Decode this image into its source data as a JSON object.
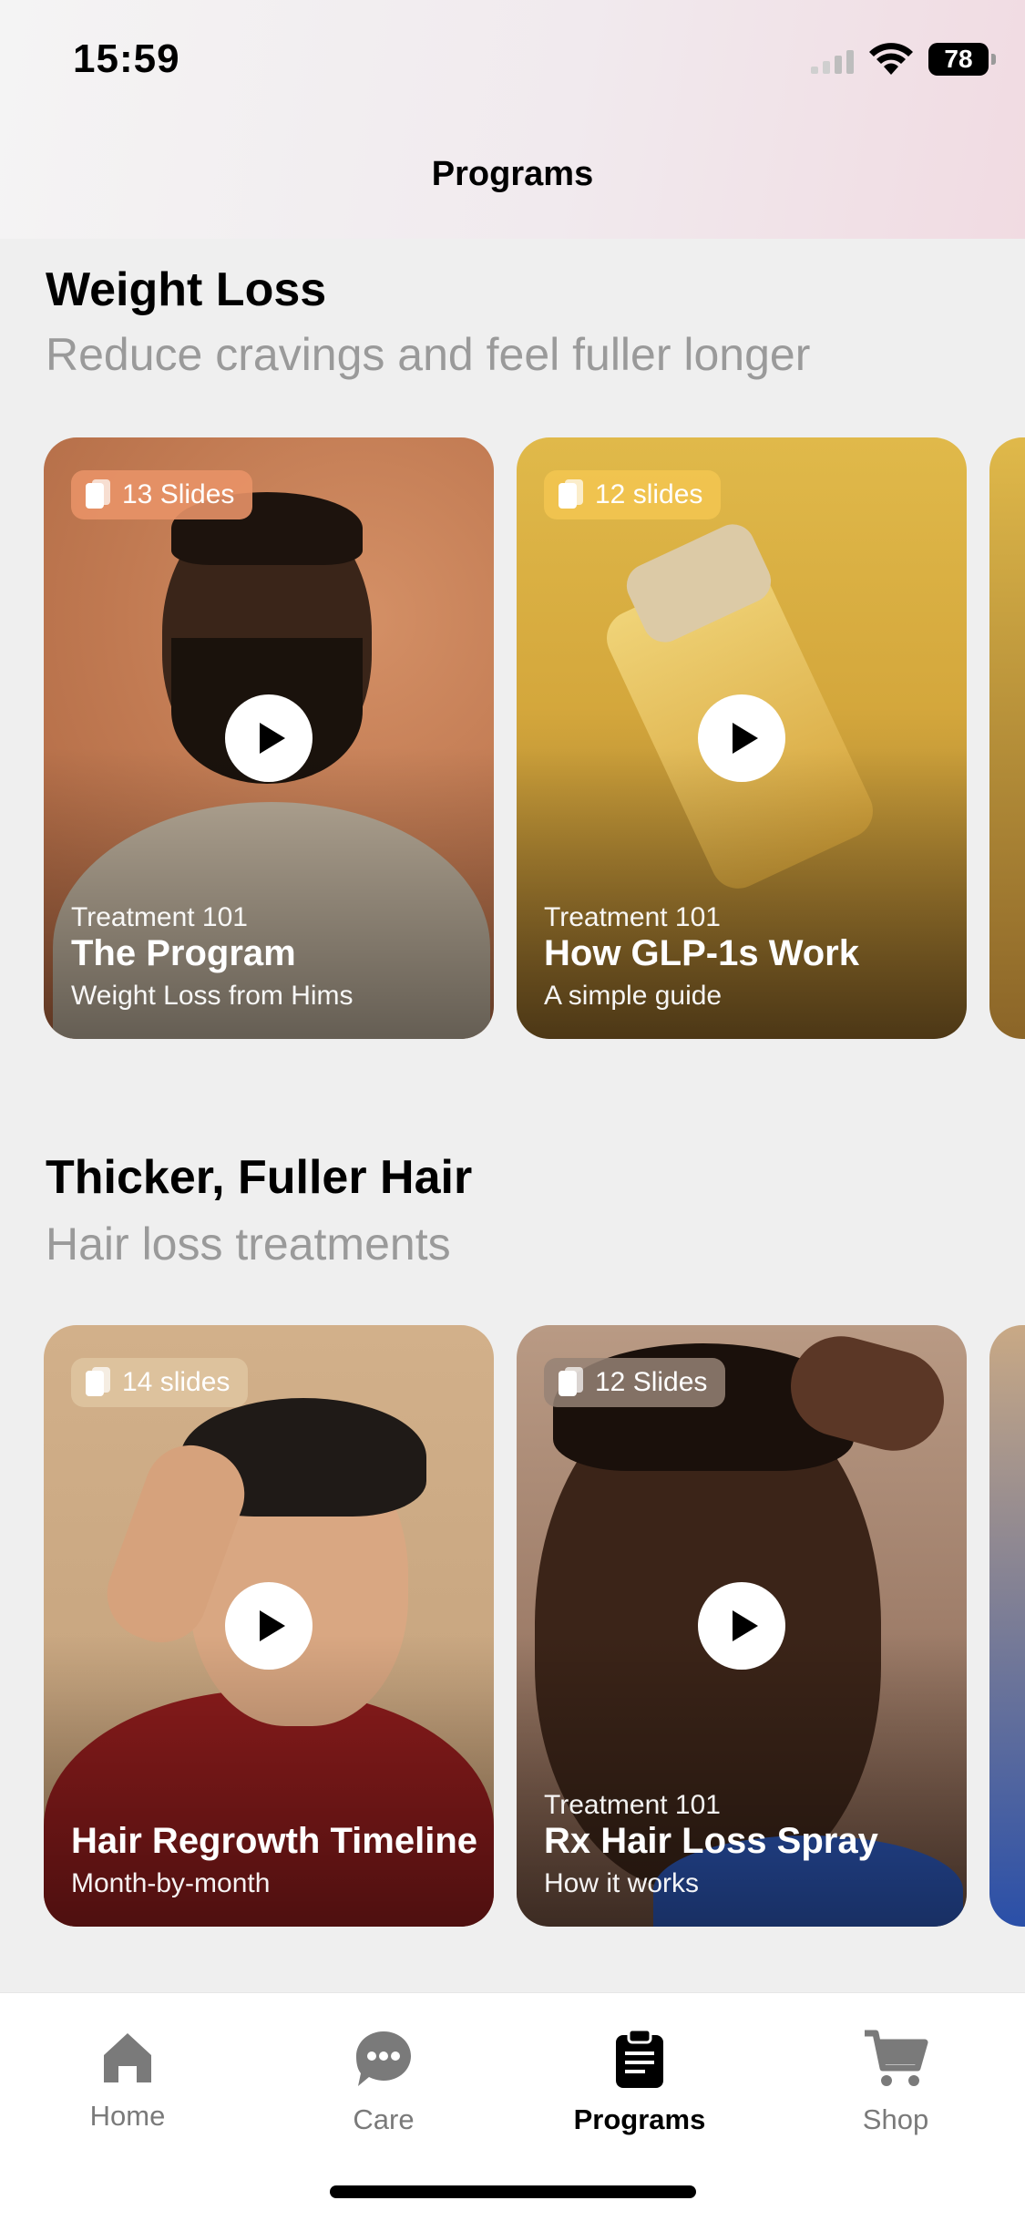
{
  "status_bar": {
    "time": "15:59",
    "battery": "78"
  },
  "header": {
    "title": "Programs"
  },
  "sections": [
    {
      "title": "Weight Loss",
      "subtitle": "Reduce cravings and feel fuller longer",
      "cards": [
        {
          "badge": "13 Slides",
          "eyebrow": "Treatment 101",
          "title": "The Program",
          "subtitle": "Weight Loss from Hims",
          "accent": "#c47e56"
        },
        {
          "badge": "12 slides",
          "eyebrow": "Treatment 101",
          "title": "How GLP-1s Work",
          "subtitle": "A simple guide",
          "accent": "#d9a93c"
        }
      ]
    },
    {
      "title": "Thicker, Fuller Hair",
      "subtitle": "Hair loss treatments",
      "cards": [
        {
          "badge": "14 slides",
          "eyebrow": "",
          "title": "Hair Regrowth Timeline",
          "subtitle": "Month-by-month",
          "accent": "#c9a985"
        },
        {
          "badge": "12 Slides",
          "eyebrow": "Treatment 101",
          "title": "Rx Hair Loss Spray",
          "subtitle": "How it works",
          "accent": "#9a7863"
        }
      ]
    }
  ],
  "tab_bar": {
    "items": [
      {
        "label": "Home",
        "icon": "home-icon"
      },
      {
        "label": "Care",
        "icon": "chat-icon"
      },
      {
        "label": "Programs",
        "icon": "clipboard-icon",
        "active": true
      },
      {
        "label": "Shop",
        "icon": "cart-icon"
      }
    ]
  }
}
